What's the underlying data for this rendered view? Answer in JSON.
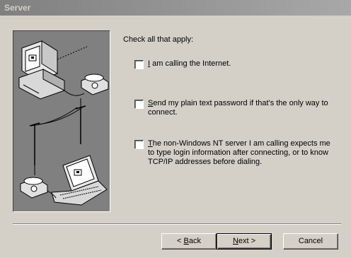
{
  "window": {
    "title": "Server"
  },
  "prompt": "Check all that apply:",
  "options": [
    {
      "mnemonic": "I",
      "rest": " am calling the Internet.",
      "checked": false
    },
    {
      "mnemonic": "S",
      "rest": "end my plain text password if that's the only way to connect.",
      "checked": false
    },
    {
      "mnemonic": "T",
      "rest": "he non-Windows NT server I am calling expects me to type login information after connecting, or to know TCP/IP addresses before dialing.",
      "checked": false
    }
  ],
  "buttons": {
    "back_prefix": "< ",
    "back_mnemonic": "B",
    "back_rest": "ack",
    "next_mnemonic": "N",
    "next_rest": "ext >",
    "cancel": "Cancel"
  },
  "icons": {
    "illustration": "computer-phone-line-laptop-icon"
  },
  "colors": {
    "dialog_bg": "#d4d0c8",
    "title_bar": "#808080",
    "illustration_bg": "#808080"
  }
}
